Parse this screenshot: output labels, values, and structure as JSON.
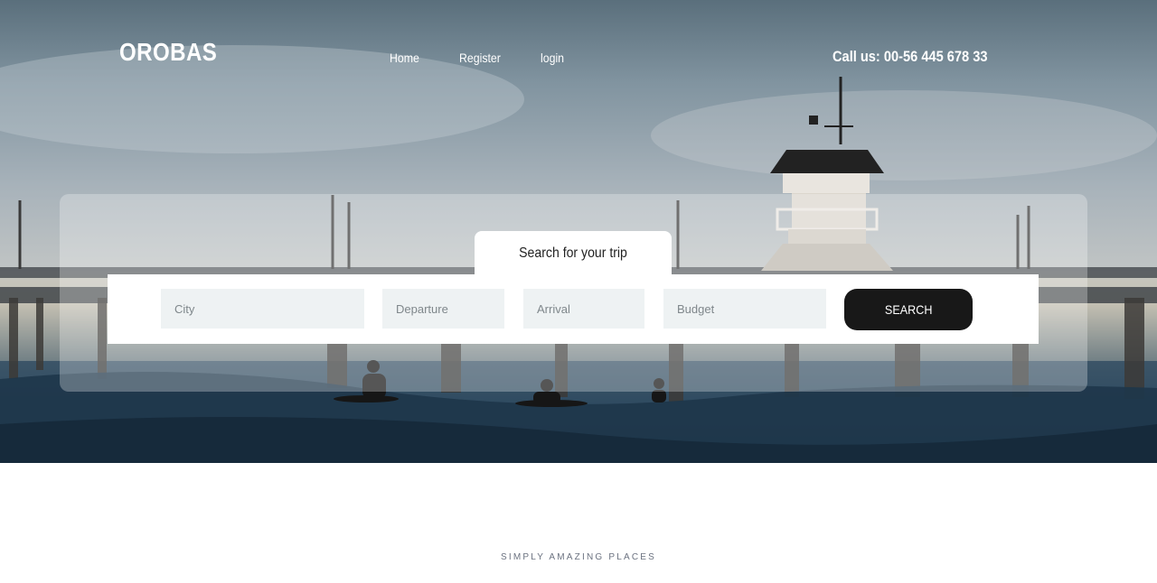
{
  "header": {
    "brand": "OROBAS",
    "nav": [
      {
        "label": "Home"
      },
      {
        "label": "Register"
      },
      {
        "label": "login"
      }
    ],
    "phone": "Call us: 00-56 445 678 33"
  },
  "search": {
    "tab_label": "Search for your trip",
    "fields": {
      "city_placeholder": "City",
      "departure_placeholder": "Departure",
      "arrival_placeholder": "Arrival",
      "budget_placeholder": "Budget"
    },
    "button_label": "SEARCH"
  },
  "section": {
    "kicker": "SIMPLY AMAZING PLACES"
  },
  "colors": {
    "button_bg": "#181818",
    "field_bg": "#eef2f3",
    "glass_overlay": "rgba(255,255,255,0.28)"
  }
}
